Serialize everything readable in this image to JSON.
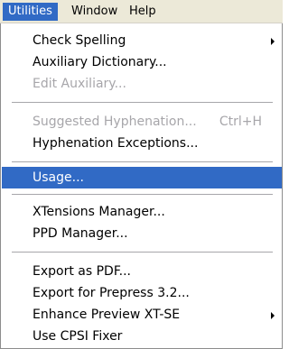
{
  "menubar": {
    "items": [
      {
        "label": "Utilities"
      },
      {
        "label": "Window"
      },
      {
        "label": "Help"
      }
    ]
  },
  "menu": {
    "items": [
      {
        "label": "Check Spelling",
        "enabled": true
      },
      {
        "label": "Auxiliary Dictionary...",
        "enabled": true
      },
      {
        "label": "Edit Auxiliary...",
        "enabled": false
      },
      {
        "label": "Suggested Hyphenation...",
        "shortcut": "Ctrl+H",
        "enabled": false
      },
      {
        "label": "Hyphenation Exceptions...",
        "enabled": true
      },
      {
        "label": "Usage...",
        "enabled": true,
        "highlighted": true
      },
      {
        "label": "XTensions Manager...",
        "enabled": true
      },
      {
        "label": "PPD Manager...",
        "enabled": true
      },
      {
        "label": "Export as PDF...",
        "enabled": true
      },
      {
        "label": "Export for Prepress 3.2...",
        "enabled": true
      },
      {
        "label": "Enhance Preview XT-SE",
        "enabled": true
      },
      {
        "label": "Use CPSI Fixer",
        "enabled": true
      }
    ]
  },
  "colors": {
    "highlight": "#316ac5",
    "disabled_text": "#a7a6aa",
    "menubar_bg": "#ece9d8"
  },
  "icons": {
    "submenu": "submenu-arrow-icon"
  }
}
